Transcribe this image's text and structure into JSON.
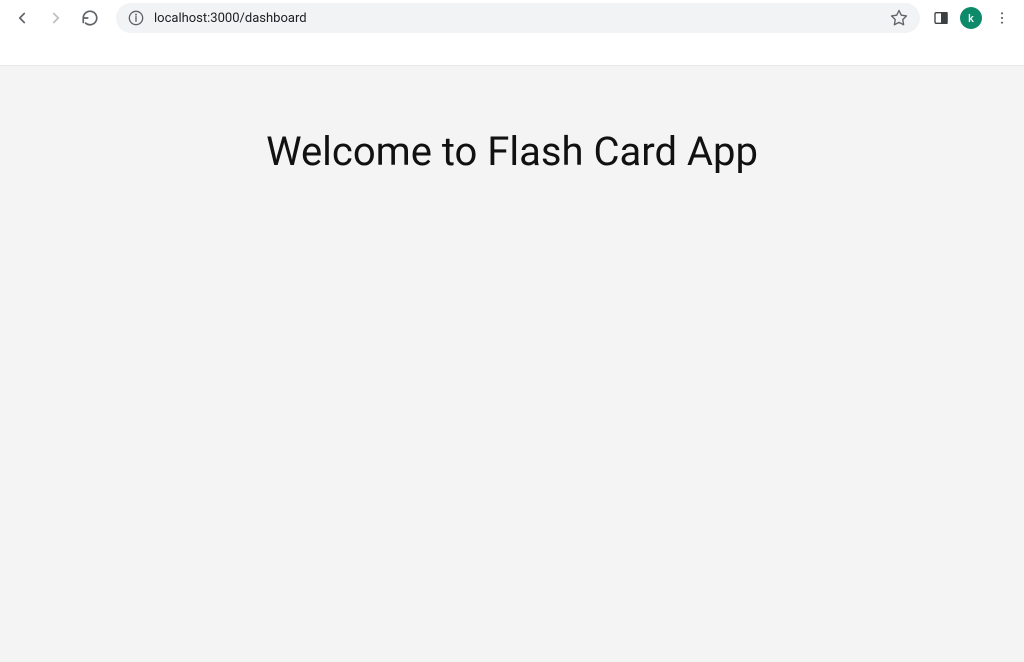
{
  "browser": {
    "url": "localhost:3000/dashboard",
    "avatar_letter": "k"
  },
  "page": {
    "heading": "Welcome to Flash Card App"
  }
}
